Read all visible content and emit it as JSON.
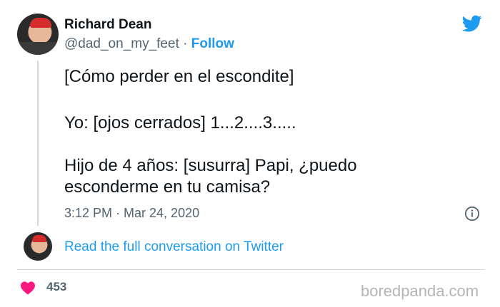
{
  "author": {
    "name": "Richard Dean",
    "handle": "@dad_on_my_feet",
    "separator": "·",
    "follow_label": "Follow"
  },
  "tweet": {
    "lines": [
      "[Cómo perder en el escondite]",
      "Yo: [ojos cerrados] 1...2....3.....",
      "Hijo de 4 años: [susurra] Papi, ¿puedo",
      "esconderme en tu camisa?"
    ],
    "timestamp": "3:12 PM · Mar 24, 2020"
  },
  "conversation_link": "Read the full conversation on Twitter",
  "likes": {
    "count": "453"
  },
  "watermark": "boredpanda.com",
  "icons": [
    "twitter-bird-icon",
    "info-icon",
    "heart-icon"
  ],
  "colors": {
    "accent": "#1d9bf0",
    "heart": "#f91880",
    "muted": "#536471"
  }
}
